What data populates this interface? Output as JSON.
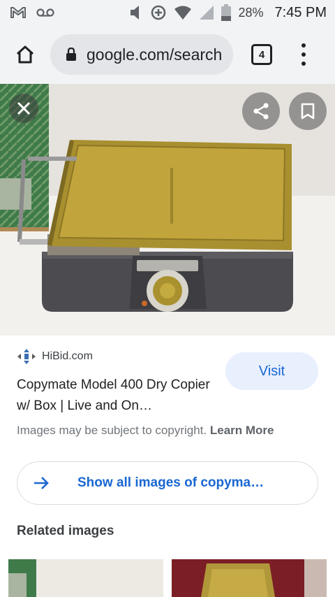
{
  "status_bar": {
    "battery_level": "28%",
    "time": "7:45 PM",
    "icons": [
      "gmail-icon",
      "voicemail-icon",
      "volume-icon",
      "data-saver-icon",
      "wifi-icon",
      "signal-icon",
      "battery-icon"
    ]
  },
  "browser": {
    "url": "google.com/search",
    "tab_count": "4",
    "icons": [
      "home-icon",
      "lock-icon",
      "tabs-icon",
      "more-vert-icon"
    ]
  },
  "viewer": {
    "icons": [
      "close-icon",
      "share-icon",
      "bookmark-icon"
    ]
  },
  "result": {
    "source": "HiBid.com",
    "title": "Copymate Model 400 Dry Copier w/ Box | Live and On…",
    "visit_label": "Visit",
    "copyright_notice": "Images may be subject to copyright.",
    "learn_more": "Learn More"
  },
  "show_all": {
    "label": "Show all images of copyma…"
  },
  "related": {
    "heading": "Related images"
  },
  "colors": {
    "link_blue": "#1967d2",
    "visit_bg": "#e8f0fe",
    "toolbar_bg": "#f1f3f4",
    "url_bar_bg": "#e3e5e8"
  }
}
